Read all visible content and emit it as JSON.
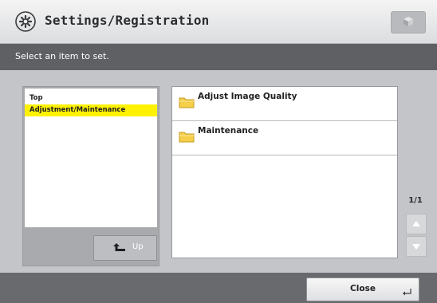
{
  "header": {
    "title": "Settings/Registration",
    "title_icon": "settings-gear-icon",
    "corner_button_icon": "cube-icon"
  },
  "message": "Select an item to set.",
  "tree": {
    "items": [
      {
        "label": "Top",
        "selected": false
      },
      {
        "label": "Adjustment/Maintenance",
        "selected": true
      }
    ],
    "up_label": "Up",
    "up_icon": "up-arrow-icon",
    "selected_color": "#fff200"
  },
  "list": {
    "items": [
      {
        "label": "Adjust Image Quality",
        "icon": "folder-icon"
      },
      {
        "label": "Maintenance",
        "icon": "folder-icon"
      }
    ]
  },
  "pager": {
    "text": "1/1",
    "prev_icon": "page-up-triangle-icon",
    "next_icon": "page-down-triangle-icon"
  },
  "footer": {
    "close_label": "Close",
    "close_icon": "enter-return-icon"
  }
}
